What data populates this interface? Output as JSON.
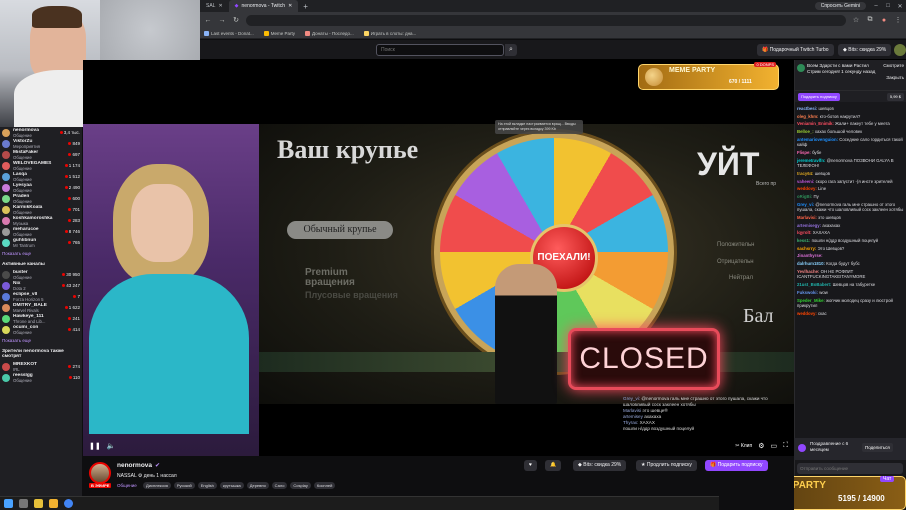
{
  "browser": {
    "tabs": [
      {
        "label": "SAL",
        "active": false
      },
      {
        "label": "nenormova - Twitch",
        "active": true
      }
    ],
    "new_tab": "+",
    "gemini": "Спросить Gemini",
    "bookmarks": [
      "Last events - Donat...",
      "Meme Party",
      "Донаты - Последо...",
      "Играть в слоты: дна..."
    ]
  },
  "twitch_nav": {
    "search_placeholder": "Поиск",
    "turbo_label": "Подарочный Twitch Turbo",
    "bits_label": "Bits: скидка 29%"
  },
  "sidebar": {
    "channels": [
      {
        "name": "nenormova",
        "game": "Общение",
        "viewers": "3,4 тыс.",
        "color": "#d9a15a"
      },
      {
        "name": "ViktorZu",
        "game": "Мероприятия",
        "viewers": "849",
        "color": "#6a7bd0"
      },
      {
        "name": "MistaFaker",
        "game": "Общение",
        "viewers": "697",
        "color": "#b44a4a"
      },
      {
        "name": "WELOVEGAMES",
        "game": "Общение",
        "viewers": "1 174",
        "color": "#e05c5c"
      },
      {
        "name": "Lasqa",
        "game": "Общение",
        "viewers": "1 512",
        "color": "#5aa0d9"
      },
      {
        "name": "Lyesyaa",
        "game": "Общение",
        "viewers": "2 490",
        "color": "#c87ad9"
      },
      {
        "name": "Praden",
        "game": "Общение",
        "viewers": "600",
        "color": "#7ad98a"
      },
      {
        "name": "KarmikKoala",
        "game": "Общение",
        "viewers": "701",
        "color": "#d9c25a"
      },
      {
        "name": "koshkamoroshka",
        "game": "Музыка",
        "viewers": "283",
        "color": "#d97ab0"
      },
      {
        "name": "meharucoe",
        "game": "Общение",
        "viewers": "8 746",
        "color": "#9a9a9a"
      },
      {
        "name": "guhlibnun",
        "game": "Mr Tantrum",
        "viewers": "765",
        "color": "#5ad9c2"
      }
    ],
    "more_1": "Показать еще",
    "active_header": "Активные каналы",
    "active_channels": [
      {
        "name": "buster",
        "game": "Общение",
        "viewers": "30 950",
        "color": "#4a4a4a"
      },
      {
        "name": "Nix",
        "game": "Dota 2",
        "viewers": "43 247",
        "color": "#7a5ad9"
      },
      {
        "name": "eclipse_vll",
        "game": "Forza Horizon 5",
        "viewers": "7",
        "color": "#5a7ad9"
      },
      {
        "name": "DMITRY_BALE",
        "game": "Marvel Rivals",
        "viewers": "1 622",
        "color": "#d98a5a"
      },
      {
        "name": "Hawkeye_111",
        "game": "Throne and Lib...",
        "viewers": "241",
        "color": "#5ad97a"
      },
      {
        "name": "ocumi_con",
        "game": "Общение",
        "viewers": "414",
        "color": "#d9d95a"
      }
    ],
    "more_2": "Показать еще",
    "also_header": "Зрители nenormova также смотрят",
    "also_channels": [
      {
        "name": "MREXKOT",
        "game": "IRL",
        "viewers": "274",
        "color": "#c94a4a"
      },
      {
        "name": "reesslgg",
        "game": "Общение",
        "viewers": "110",
        "color": "#4ac9a9"
      }
    ]
  },
  "video": {
    "title_big": "Ваш крупье",
    "btn_regular": "Обычный крупье",
    "premium_label": "Premium вращения",
    "premium_sub": "Плусовые вращения",
    "wheel_button": "ПОЕХАЛИ!",
    "word_right": "УЙТ",
    "word_right_sub": "Всего пр",
    "side_options": [
      "Положительн",
      "Отрицательн",
      "Нейтрал"
    ],
    "bal_text": "Бал",
    "closed_sign": "CLOSED",
    "popup_note": "На этой вкладке настраивается вращ... Вводы отправляйте через вкладку 399 Kb",
    "overlay_chat": [
      {
        "user": "Grey_vi:",
        "text": "@nenormova галь мне страшно от этого пушала, скажи что шаловливый соск заклеен хотябы"
      },
      {
        "user": "Marlavisi",
        "text": "это шевце®"
      },
      {
        "user": "artemisey",
        "text": "ахахаха"
      },
      {
        "user": "Thyrax:",
        "text": "ХАХАХ"
      },
      {
        "user": "",
        "text": "пошли н/ддр воздушный поцелуй"
      }
    ],
    "clip_label": "Клип"
  },
  "meme_top": {
    "title": "MEME PARTY",
    "count": "670 / 1111",
    "badge": "0 DONPS"
  },
  "meme_bottom": {
    "title": "MEME PARTY",
    "count": "5195 / 14900",
    "badge": "0 DONPS"
  },
  "infobar": {
    "channel_name": "nenormova",
    "live_badge": "В ЭФИРЕ",
    "stream_title": "NASSAL ⚙ день 1 нассал",
    "category": "Общение",
    "tags": [
      "Дисплексия",
      "Русский",
      "English",
      "крутышка",
      "Деревня",
      "Сало",
      "Cosplay",
      "Косплей"
    ],
    "bits_label": "Bits: скидка 29%",
    "sub_label": "Продлить подписку",
    "gift_label": "Подарить подписку"
  },
  "chat": {
    "notif_text": "Всем Здарсти с вами Растил Стрим сегодня! 1 секунду назад",
    "notif_actions": [
      "Смотрите",
      "Закрыть"
    ],
    "gift_btn": "Подарить подписку",
    "gift_cost": "5,99 $",
    "messages": [
      {
        "user": "reactbesi:",
        "text": "шевцов",
        "color": "#8ab4f8"
      },
      {
        "user": "oleg_khm:",
        "text": "кто-ботов накрутил?",
        "color": "#ff7f50"
      },
      {
        "user": "Veniamin_Enimik:",
        "text": "Жали+ пакеут тебе у меета",
        "color": "#ff4d61"
      },
      {
        "user": "Belloe_:",
        "text": "хахах большой человек",
        "color": "#9acd32"
      },
      {
        "user": "antemariovenguion:",
        "text": "Соседние сало гордиться такой кайф",
        "color": "#1e90ff"
      },
      {
        "user": "Flispe:",
        "text": "бубе",
        "color": "#ff69b4"
      },
      {
        "user": "jeremetravlfn:",
        "text": "@nenormova ПОЗВОНИ GALYA В ТЕЛЕФОН!",
        "color": "#00ced1"
      },
      {
        "user": "tracy64:",
        "text": "шевцов",
        "color": "#daa520"
      },
      {
        "user": "vaheeni:",
        "text": "скоро гага запустит -(я инсте зрителей",
        "color": "#ba55d3"
      },
      {
        "user": "weddovy:",
        "text": "Line",
        "color": "#ff4500"
      },
      {
        "user": "oRigBi:",
        "text": "Пу",
        "color": "#2e8b57"
      },
      {
        "user": "Grey_vi:",
        "text": "@nenormova галь мне страшно от этого пушала, скажи что шаловливый соск заклеен хотябы",
        "color": "#1e90ff"
      },
      {
        "user": "Marlavisi:",
        "text": "это шевцов",
        "color": "#ff6347"
      },
      {
        "user": "artemisegy:",
        "text": "ахахахах",
        "color": "#9370db"
      },
      {
        "user": "lqyrolt:",
        "text": "ХАХАХА",
        "color": "#ff4d61"
      },
      {
        "user": "kess1:",
        "text": "пошли н/ддр воздушный поцелуй",
        "color": "#3cb371"
      },
      {
        "user": "sachsrry:",
        "text": "Это Шевцов?",
        "color": "#ffa500"
      },
      {
        "user": "Jinanthyrse:",
        "text": "",
        "color": "#da70d6"
      },
      {
        "user": "dalrhum1810:",
        "text": "Когда будут бубс",
        "color": "#87cefa"
      },
      {
        "user": "Yevlhache:",
        "text": "ОН НЕ РОФЛИТ ICANTFUCKINGTAKEITANYMORE",
        "color": "#f08080"
      },
      {
        "user": "21ust_BoBabert:",
        "text": "Шевцов на табуретке",
        "color": "#20b2aa"
      },
      {
        "user": "Fukswoki:",
        "text": "wow",
        "color": "#6495ed"
      },
      {
        "user": "Speder_Mike:",
        "text": "жопчик молодец сразу и люстрой прикрутил",
        "color": "#32cd32"
      },
      {
        "user": "weddovy:",
        "text": "скас",
        "color": "#ff4500"
      }
    ],
    "sub_banner": "Поздравление с 6 месяцем",
    "sub_banner_btn": "Поделиться",
    "input_placeholder": "Отправить сообщение",
    "chat_btn": "Чат"
  }
}
